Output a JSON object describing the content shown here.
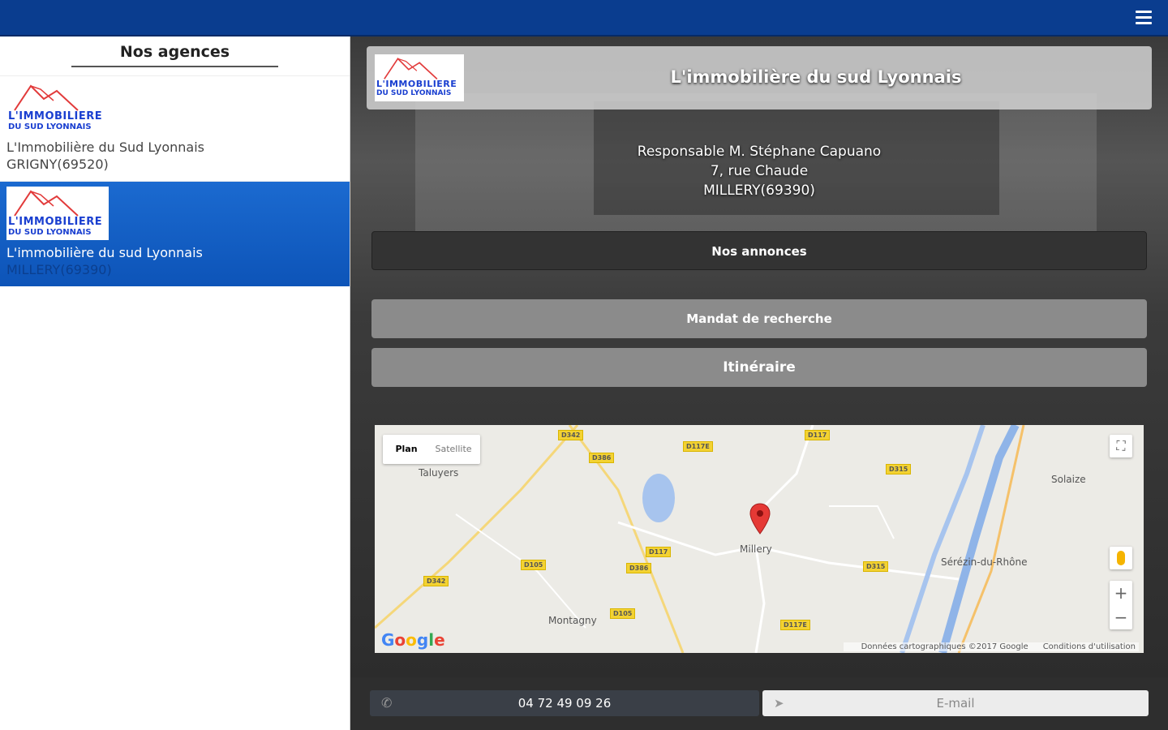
{
  "sidebar": {
    "title": "Nos agences",
    "items": [
      {
        "logo_line1": "L'IMMOBILIERE",
        "logo_line2": "DU SUD LYONNAIS",
        "name": "L'Immobilière du Sud Lyonnais",
        "city": "GRIGNY(69520)",
        "selected": false
      },
      {
        "logo_line1": "L'IMMOBILIERE",
        "logo_line2": "DU SUD LYONNAIS",
        "name": "L'immobilière du sud Lyonnais",
        "city": "MILLERY(69390)",
        "selected": true
      }
    ]
  },
  "header": {
    "title": "L'immobilière du sud Lyonnais",
    "logo_line1": "L'IMMOBILIERE",
    "logo_line2": "DU SUD LYONNAIS"
  },
  "address": {
    "line1": "Responsable M. Stéphane Capuano",
    "line2": "7, rue Chaude",
    "line3": "MILLERY(69390)"
  },
  "buttons": {
    "annonces": "Nos annonces",
    "mandat": "Mandat de recherche",
    "itineraire": "Itinéraire"
  },
  "map": {
    "toggle_plan": "Plan",
    "toggle_satellite": "Satellite",
    "labels": [
      "Taluyers",
      "Millery",
      "Montagny",
      "Sérézin-du-Rhône",
      "Solaize"
    ],
    "roads": [
      "D342",
      "D386",
      "D117E",
      "D117",
      "D315",
      "D105",
      "D386",
      "D117",
      "D342",
      "D105",
      "D117E",
      "D315"
    ],
    "footer_data": "Données cartographiques ©2017 Google",
    "footer_terms": "Conditions d'utilisation",
    "zoom_in": "+",
    "zoom_out": "−",
    "fullscreen": "⛶"
  },
  "footer": {
    "phone": "04 72 49 09 26",
    "email": "E-mail"
  }
}
